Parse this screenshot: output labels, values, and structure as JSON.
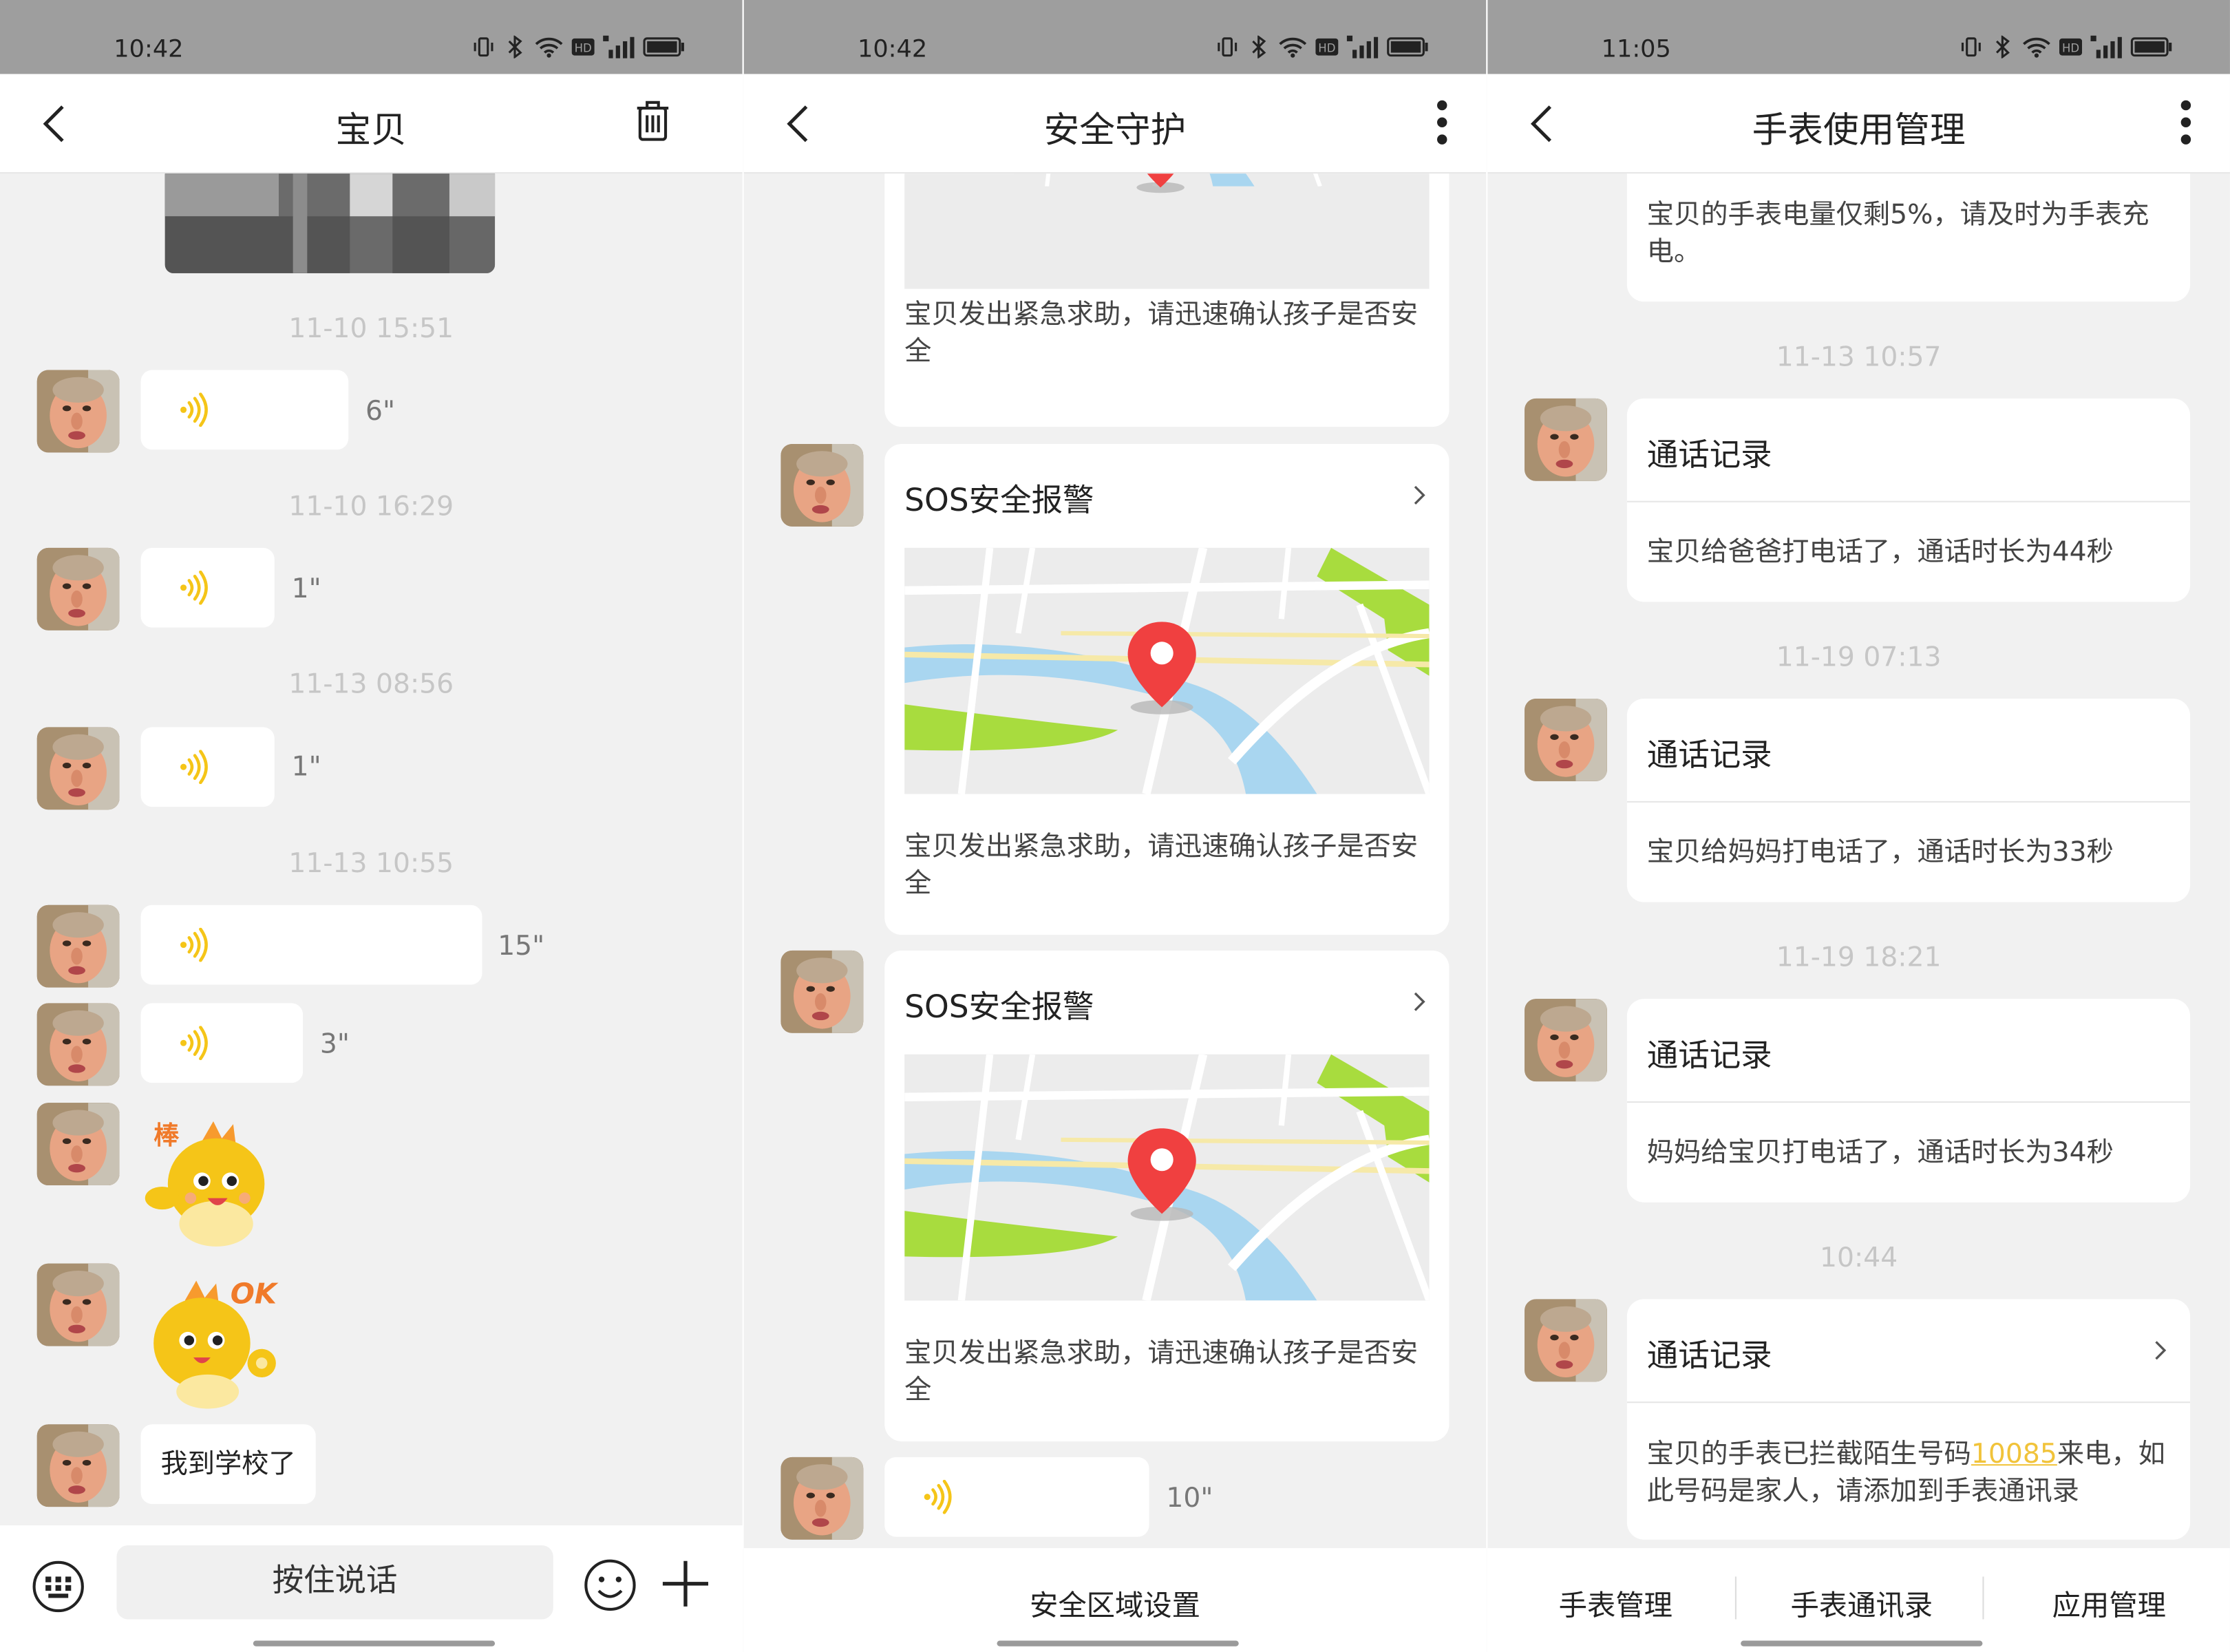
{
  "screens": [
    {
      "status_time": "10:42",
      "title": "宝贝",
      "messages": [
        {
          "time": "11-10 15:51",
          "duration": "6\""
        },
        {
          "time": "11-10 16:29",
          "duration": "1\""
        },
        {
          "time": "11-13 08:56",
          "duration": "1\""
        },
        {
          "time": "11-13 10:55",
          "duration": "15\""
        },
        {
          "duration": "3\""
        }
      ],
      "sticker_texts": [
        "棒",
        "OK"
      ],
      "text_message": "我到学校了",
      "talk_button": "按住说话"
    },
    {
      "status_time": "10:42",
      "title": "安全守护",
      "alert_desc": "宝贝发出紧急求助，请迅速确认孩子是否安全",
      "cards": [
        {
          "title": "SOS安全报警",
          "desc": "宝贝发出紧急求助，请迅速确认孩子是否安全"
        },
        {
          "title": "SOS安全报警",
          "desc": "宝贝发出紧急求助，请迅速确认孩子是否安全"
        }
      ],
      "voice_duration": "10\"",
      "footer_label": "安全区域设置"
    },
    {
      "status_time": "11:05",
      "title": "手表使用管理",
      "battery_msg": "宝贝的手表电量仅剩5%，请及时为手表充电。",
      "records": [
        {
          "time": "11-13 10:57",
          "title": "通话记录",
          "desc": "宝贝给爸爸打电话了，通话时长为44秒"
        },
        {
          "time": "11-19 07:13",
          "title": "通话记录",
          "desc": "宝贝给妈妈打电话了，通话时长为33秒"
        },
        {
          "time": "11-19 18:21",
          "title": "通话记录",
          "desc": "妈妈给宝贝打电话了，通话时长为34秒"
        },
        {
          "time": "10:44",
          "title": "通话记录",
          "desc_pre": "宝贝的手表已拦截陌生号码",
          "desc_num": "10085",
          "desc_post": "来电，如此号码是家人，请添加到手表通讯录"
        }
      ],
      "tabs": [
        "手表管理",
        "手表通讯录",
        "应用管理"
      ]
    }
  ],
  "colors": {
    "accent_yellow": "#f5c518",
    "map_water": "#a9d6f0",
    "map_green": "#a8dc3e",
    "pin_red": "#f04040"
  }
}
